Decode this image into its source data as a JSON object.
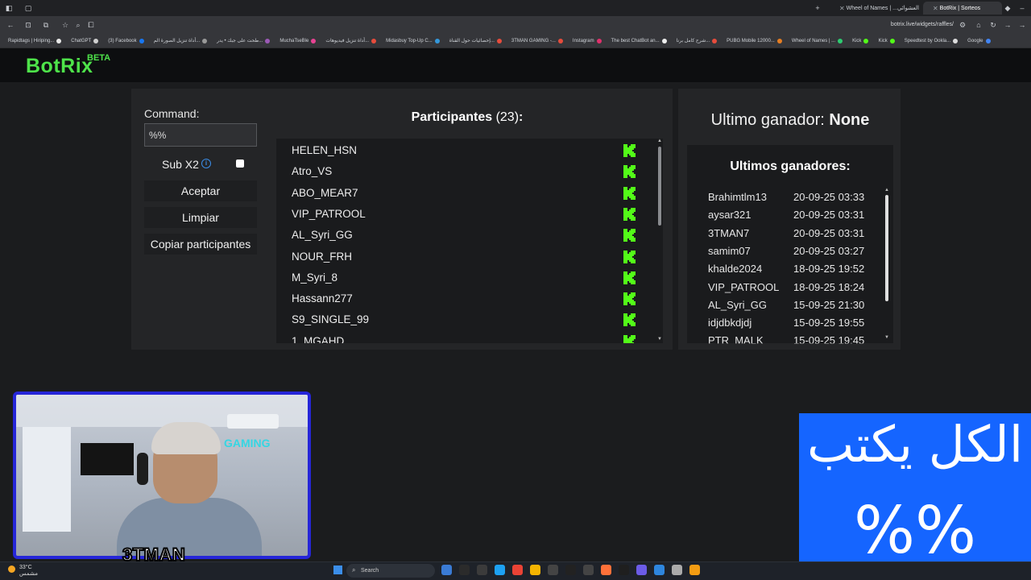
{
  "browser": {
    "tabs": [
      {
        "title": "Wheel of Names | ...اسم العشوائي",
        "active": false
      },
      {
        "title": "BotRix | Sorteos",
        "active": true
      }
    ],
    "url": "botrix.live/widgets/raffles/",
    "bookmarks": [
      {
        "label": "Rapidtags | Hiriping...",
        "color": "#e8e8e8"
      },
      {
        "label": "ChatGPT",
        "color": "#d0d0d0"
      },
      {
        "label": "(3) Facebook",
        "color": "#1877f2"
      },
      {
        "label": "أداة تنزيل الصورة الم...",
        "color": "#999999"
      },
      {
        "label": "طحت على جبك • يدر...",
        "color": "#9b59b6"
      },
      {
        "label": "MuchaTseBle",
        "color": "#e84393"
      },
      {
        "label": "أداة تنزيل فيديوهات...",
        "color": "#e74c3c"
      },
      {
        "label": "Midasbuy Top-Up C...",
        "color": "#3498db"
      },
      {
        "label": "إحصائيات حول القناة...",
        "color": "#e74c3c"
      },
      {
        "label": "3TMAN GAMING -...",
        "color": "#e74c3c"
      },
      {
        "label": "Instagram",
        "color": "#e1306c"
      },
      {
        "label": "The best ChatBot an...",
        "color": "#eeeeee"
      },
      {
        "label": "شرح كامل برنا...",
        "color": "#e74c3c"
      },
      {
        "label": "PUBG Mobile 12000...",
        "color": "#e67e22"
      },
      {
        "label": "Wheel of Names | ...",
        "color": "#2ecc71"
      },
      {
        "label": "Kick",
        "color": "#53fc18"
      },
      {
        "label": "Kick",
        "color": "#53fc18"
      },
      {
        "label": "Speedtest by Ookla...",
        "color": "#dddddd"
      },
      {
        "label": "Google",
        "color": "#4285f4"
      }
    ]
  },
  "app": {
    "logo": "BotRix",
    "beta": "BETA"
  },
  "command": {
    "label": "Command:",
    "value": "%%",
    "sub_label": "Sub X2",
    "accept": "Aceptar",
    "clear": "Limpiar",
    "copy": "Copiar participantes"
  },
  "participants": {
    "title": "Participantes",
    "count": "(23)",
    "colon": ":",
    "names": [
      "HELEN_HSN",
      "Atro_VS",
      "ABO_MEAR7",
      "VIP_PATROOL",
      "AL_Syri_GG",
      "NOUR_FRH",
      "M_Syri_8",
      "Hassann277",
      "S9_SINGLE_99",
      "1_MGAHD"
    ]
  },
  "winner": {
    "label": "Ultimo ganador:",
    "value": "None",
    "list_title": "Ultimos ganadores:",
    "rows": [
      {
        "name": "Brahimtlm13",
        "date": "20-09-25 03:33"
      },
      {
        "name": "aysar321",
        "date": "20-09-25 03:31"
      },
      {
        "name": "3TMAN7",
        "date": "20-09-25 03:31"
      },
      {
        "name": "samim07",
        "date": "20-09-25 03:27"
      },
      {
        "name": "khalde2024",
        "date": "18-09-25 19:52"
      },
      {
        "name": "VIP_PATROOL",
        "date": "18-09-25 18:24"
      },
      {
        "name": "AL_Syri_GG",
        "date": "15-09-25 21:30"
      },
      {
        "name": "idjdbkdjdj",
        "date": "15-09-25 19:55"
      },
      {
        "name": "PTR_MALK",
        "date": "15-09-25 19:45"
      }
    ]
  },
  "webcam": {
    "wall_text": "GAMING",
    "streamer_tag": "3TMAN"
  },
  "overlay": {
    "line1": "الكل يكتب",
    "line2": "%%"
  },
  "taskbar": {
    "temp": "33°C",
    "weather": "مشمس",
    "search": "Search"
  },
  "colors": {
    "brand": "#4ee34a",
    "kick": "#53fc18",
    "overlay": "#1565ff",
    "webcam_border": "#2626d8"
  }
}
